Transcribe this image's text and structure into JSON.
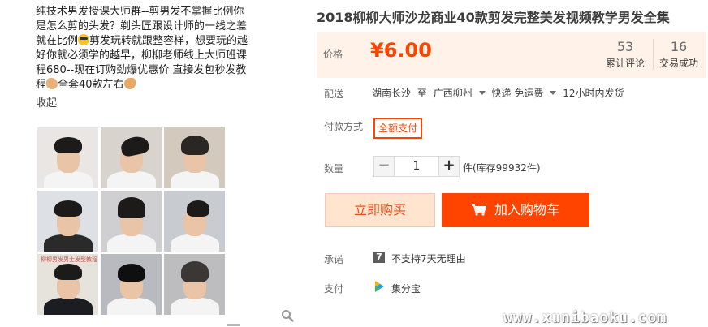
{
  "promo": {
    "text_1": "纯技术男发授课大师群--剪男发不掌握比例你是怎么剪的头发？剃头匠跟设计师的一线之差就在比例",
    "text_2": "剪发玩转就跟整容样，想要玩的越好你就必须学的越早，柳柳老师线上大师班课程680--现在订购劲爆优惠价  直接发包秒发教程",
    "text_3": "全套40款左右",
    "collapse": "收起",
    "photo_caption": "柳柳男发男士发型教程"
  },
  "product": {
    "title": "2018柳柳大师沙龙商业40款剪发完整美发视频教学男发全集",
    "price_label": "价格",
    "price": "¥6.00",
    "reviews_count": "53",
    "reviews_label": "累计评论",
    "sold_count": "16",
    "sold_label": "交易成功"
  },
  "shipping": {
    "label": "配送",
    "from": "湖南长沙",
    "to_word": "至",
    "to": "广西柳州",
    "method": "快递 免运费",
    "dispatch": "12小时内发货"
  },
  "payment": {
    "label": "付款方式",
    "option": "全额支付"
  },
  "quantity": {
    "label": "数量",
    "minus": "−",
    "value": "1",
    "plus": "+",
    "stock": "件(库存99932件)"
  },
  "actions": {
    "buy_now": "立即购买",
    "add_to_cart": "加入购物车"
  },
  "promise": {
    "label": "承诺",
    "icon_text": "7",
    "text": "不支持7天无理由"
  },
  "pay": {
    "label": "支付",
    "text": "集分宝"
  },
  "watermark": "www.xunibaoku.com",
  "colors": {
    "accent": "#ff4400",
    "price_bg": "#fff2e8",
    "buy_bg": "#ffe4d0"
  },
  "icons": [
    "emoji-glasses-icon",
    "emoji-arm-icon",
    "emoji-hand-icon",
    "zoom-icon",
    "cart-icon",
    "seven-day-icon",
    "jifenbao-icon",
    "caret-down-icon"
  ]
}
